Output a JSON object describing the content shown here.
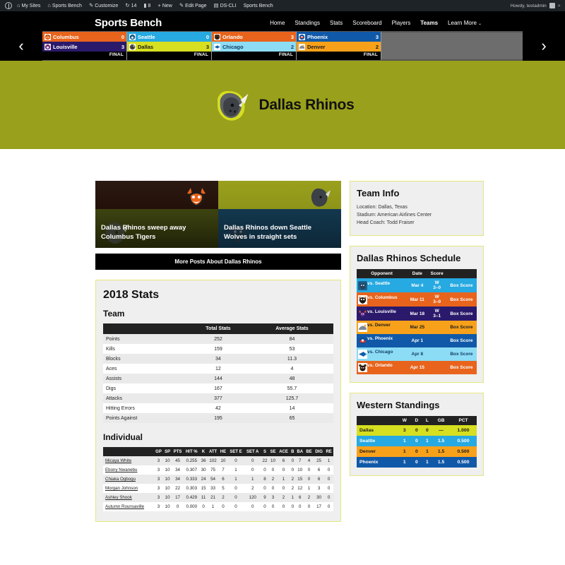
{
  "adminbar": {
    "items": [
      {
        "icon": "wordpress-icon",
        "label": ""
      },
      {
        "icon": "sites-icon",
        "label": "My Sites"
      },
      {
        "icon": "home-icon",
        "label": "Sports Bench"
      },
      {
        "icon": "pencil-icon",
        "label": "Customize"
      },
      {
        "icon": "updates-icon",
        "label": "14"
      },
      {
        "icon": "comment-icon",
        "label": "8"
      },
      {
        "icon": "plus-icon",
        "label": "New"
      },
      {
        "icon": "edit-icon",
        "label": "Edit Page"
      },
      {
        "icon": "terminal-icon",
        "label": "DS-CLI"
      },
      {
        "icon": "",
        "label": "Sports Bench"
      }
    ],
    "howdy": "Howdy, testadmin",
    "search_icon": "search-icon"
  },
  "header": {
    "site_title": "Sports Bench",
    "nav": [
      {
        "label": "Home",
        "active": false
      },
      {
        "label": "Standings",
        "active": false
      },
      {
        "label": "Stats",
        "active": false
      },
      {
        "label": "Scoreboard",
        "active": false
      },
      {
        "label": "Players",
        "active": false
      },
      {
        "label": "Teams",
        "active": true
      },
      {
        "label": "Learn More",
        "active": false,
        "caret": "⌄"
      }
    ]
  },
  "scoreboard": {
    "prev_arrow": "‹",
    "next_arrow": "›",
    "games": [
      {
        "status": "FINAL",
        "away": {
          "team": "Columbus",
          "score": "0",
          "bg": "#e8641c",
          "fg": "#ffffff"
        },
        "home": {
          "team": "Louisville",
          "score": "3",
          "bg": "#2b1a6b",
          "fg": "#ffffff"
        }
      },
      {
        "status": "FINAL",
        "away": {
          "team": "Seattle",
          "score": "0",
          "bg": "#27a9e1",
          "fg": "#ffffff"
        },
        "home": {
          "team": "Dallas",
          "score": "3",
          "bg": "#d6df20",
          "fg": "#1a1a1a"
        }
      },
      {
        "status": "FINAL",
        "away": {
          "team": "Orlando",
          "score": "3",
          "bg": "#e8641c",
          "fg": "#ffffff"
        },
        "home": {
          "team": "Chicago",
          "score": "2",
          "bg": "#8ddcf5",
          "fg": "#123e66"
        }
      },
      {
        "status": "FINAL",
        "away": {
          "team": "Phoenix",
          "score": "3",
          "bg": "#1059a8",
          "fg": "#ffffff"
        },
        "home": {
          "team": "Denver",
          "score": "2",
          "bg": "#f7a11a",
          "fg": "#1a1a1a"
        }
      }
    ]
  },
  "hero": {
    "team_name": "Dallas Rhinos",
    "logo": "rhino-logo",
    "bg": "#99a01b"
  },
  "posts": [
    {
      "title": "Dallas Rhinos sweep away Columbus Tigers",
      "top_logo": "tiger-logo",
      "bottom_logo": "rhino-logo"
    },
    {
      "title": "Dallas Rhinos down Seattle Wolves in straight sets",
      "top_logo": "rhino-logo",
      "bottom_logo": "wolf-logo"
    }
  ],
  "more_posts_label": "More Posts About Dallas Rhinos",
  "team_info": {
    "heading": "Team Info",
    "location": "Location: Dallas, Texas",
    "stadium": "Stadium: American Airlines Center",
    "coach": "Head Coach: Todd Fraiser"
  },
  "schedule": {
    "heading": "Dallas Rhinos Schedule",
    "columns": [
      "Opponent",
      "Date",
      "Score",
      ""
    ],
    "rows": [
      {
        "opponent": "vs. Seattle",
        "date": "Mar 4",
        "result": "W",
        "score": "3–0",
        "link": "Box Score",
        "bg": "#27a9e1",
        "fg": "#ffffff",
        "logo": "wolf-logo"
      },
      {
        "opponent": "vs. Columbus",
        "date": "Mar 11",
        "result": "W",
        "score": "3–0",
        "link": "Box Score",
        "bg": "#e8641c",
        "fg": "#ffffff",
        "logo": "tiger-logo"
      },
      {
        "opponent": "vs. Louisville",
        "date": "Mar 18",
        "result": "W",
        "score": "3–1",
        "link": "Box Score",
        "bg": "#2b1a6b",
        "fg": "#ffffff",
        "logo": "bull-logo"
      },
      {
        "opponent": "vs. Denver",
        "date": "Mar 25",
        "result": "",
        "score": "",
        "link": "Box Score",
        "bg": "#f7a11a",
        "fg": "#1a1a1a",
        "logo": "bronco-logo"
      },
      {
        "opponent": "vs. Phoenix",
        "date": "Apr 1",
        "result": "",
        "score": "",
        "link": "Box Score",
        "bg": "#1059a8",
        "fg": "#ffffff",
        "logo": "bird-logo"
      },
      {
        "opponent": "vs. Chicago",
        "date": "Apr 8",
        "result": "",
        "score": "",
        "link": "Box Score",
        "bg": "#8ddcf5",
        "fg": "#123e66",
        "logo": "fish-logo"
      },
      {
        "opponent": "vs. Orlando",
        "date": "Apr 15",
        "result": "",
        "score": "",
        "link": "Box Score",
        "bg": "#e8641c",
        "fg": "#ffffff",
        "logo": "bear-logo"
      }
    ]
  },
  "standings": {
    "heading": "Western Standings",
    "columns": [
      "",
      "W",
      "D",
      "L",
      "GB",
      "PCT"
    ],
    "rows": [
      {
        "team": "Dallas",
        "w": "3",
        "d": "0",
        "l": "0",
        "gb": "—",
        "pct": "1.000",
        "bg": "#d6df20",
        "fg": "#1a1a1a"
      },
      {
        "team": "Seattle",
        "w": "1",
        "d": "0",
        "l": "1",
        "gb": "1.5",
        "pct": "0.500",
        "bg": "#27a9e1",
        "fg": "#ffffff"
      },
      {
        "team": "Denver",
        "w": "1",
        "d": "0",
        "l": "1",
        "gb": "1.5",
        "pct": "0.500",
        "bg": "#f7a11a",
        "fg": "#1a1a1a"
      },
      {
        "team": "Phoenix",
        "w": "1",
        "d": "0",
        "l": "1",
        "gb": "1.5",
        "pct": "0.500",
        "bg": "#1059a8",
        "fg": "#ffffff"
      }
    ]
  },
  "stats": {
    "heading": "2018 Stats",
    "team_heading": "Team",
    "team_columns": [
      "",
      "Total Stats",
      "Average Stats"
    ],
    "team_rows": [
      {
        "label": "Points",
        "total": "252",
        "avg": "84"
      },
      {
        "label": "Kills",
        "total": "159",
        "avg": "53"
      },
      {
        "label": "Blocks",
        "total": "34",
        "avg": "11.3"
      },
      {
        "label": "Aces",
        "total": "12",
        "avg": "4"
      },
      {
        "label": "Assists",
        "total": "144",
        "avg": "48"
      },
      {
        "label": "Digs",
        "total": "167",
        "avg": "55.7"
      },
      {
        "label": "Attacks",
        "total": "377",
        "avg": "125.7"
      },
      {
        "label": "Hitting Errors",
        "total": "42",
        "avg": "14"
      },
      {
        "label": "Points Against",
        "total": "195",
        "avg": "65"
      }
    ],
    "individual_heading": "Individual",
    "individual_columns": [
      "",
      "GP",
      "SP",
      "PTS",
      "HIT %",
      "K",
      "ATT",
      "HE",
      "SET E",
      "SET A",
      "S",
      "SE",
      "ACE",
      "B",
      "BA",
      "BE",
      "DIG",
      "RE"
    ],
    "individual_rows": [
      {
        "name": "Micaya White",
        "v": [
          "3",
          "10",
          "45",
          "0.255",
          "36",
          "102",
          "10",
          "0",
          "0",
          "22",
          "10",
          "6",
          "0",
          "7",
          "4",
          "25",
          "1"
        ]
      },
      {
        "name": "Ebony Nwanebu",
        "v": [
          "3",
          "10",
          "34",
          "0.307",
          "30",
          "75",
          "7",
          "1",
          "0",
          "0",
          "0",
          "0",
          "0",
          "10",
          "0",
          "6",
          "0"
        ]
      },
      {
        "name": "Chiaka Ogbogu",
        "v": [
          "3",
          "10",
          "34",
          "0.333",
          "24",
          "54",
          "6",
          "1",
          "1",
          "8",
          "2",
          "1",
          "2",
          "15",
          "0",
          "6",
          "0"
        ]
      },
      {
        "name": "Morgan Johnson",
        "v": [
          "3",
          "10",
          "22",
          "0.303",
          "15",
          "33",
          "5",
          "0",
          "2",
          "0",
          "0",
          "0",
          "2",
          "12",
          "1",
          "3",
          "0"
        ]
      },
      {
        "name": "Ashley Shook",
        "v": [
          "3",
          "10",
          "17",
          "0.429",
          "11",
          "21",
          "2",
          "0",
          "120",
          "9",
          "3",
          "2",
          "1",
          "6",
          "2",
          "30",
          "0"
        ]
      },
      {
        "name": "Autumn Rounsaville",
        "v": [
          "3",
          "10",
          "0",
          "0.000",
          "0",
          "1",
          "0",
          "0",
          "0",
          "0",
          "0",
          "0",
          "0",
          "0",
          "0",
          "17",
          "0"
        ]
      }
    ]
  }
}
